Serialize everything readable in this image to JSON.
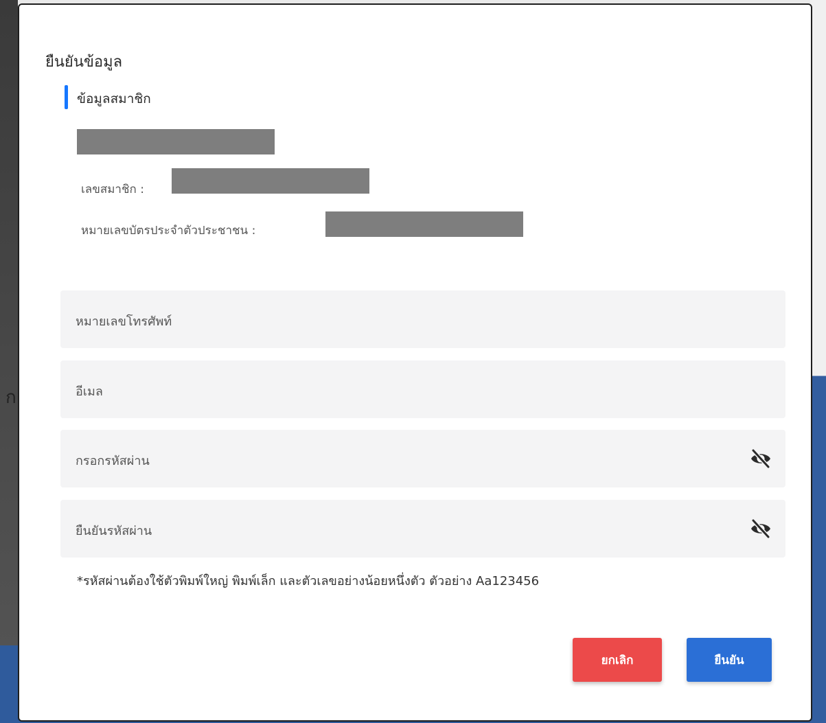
{
  "modal": {
    "title": "ยืนยันข้อมูล",
    "section_label": "ข้อมูลสมาชิก"
  },
  "member": {
    "member_no_label": "เลขสมาชิก :",
    "id_card_label": "หมายเลขบัตรประจำตัวประชาชน :"
  },
  "form": {
    "phone_placeholder": "หมายเลขโทรศัพท์",
    "email_placeholder": "อีเมล",
    "password_placeholder": "กรอกรหัสผ่าน",
    "confirm_password_placeholder": "ยืนยันรหัสผ่าน",
    "hint": "*รหัสผ่านต้องใช้ตัวพิมพ์ใหญ่ พิมพ์เล็ก และตัวเลขอย่างน้อยหนึ่งตัว ตัวอย่าง Aa123456"
  },
  "buttons": {
    "cancel": "ยกเลิก",
    "confirm": "ยืนยัน"
  },
  "backdrop": {
    "partial_text": "ก"
  },
  "colors": {
    "accent_bar": "#1677ff",
    "cancel": "#ec4a4a",
    "confirm": "#2b6fd6",
    "input_bg": "#f4f4f5"
  },
  "icons": {
    "password_toggle": "eye-off-icon"
  }
}
